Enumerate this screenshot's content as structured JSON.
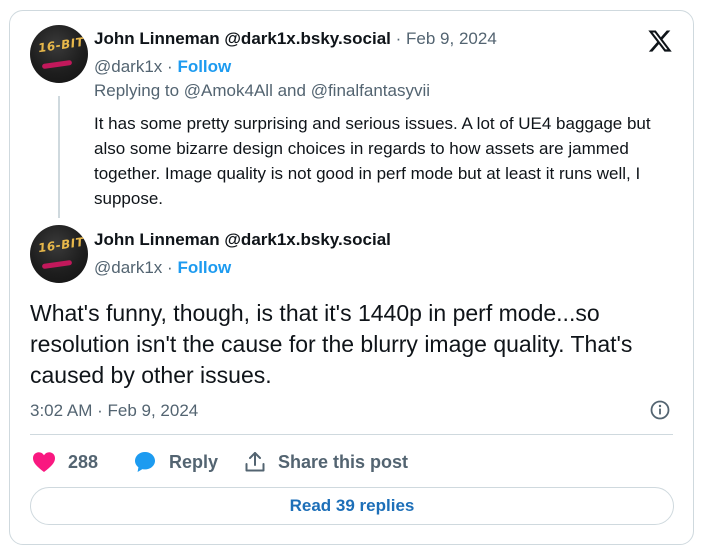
{
  "reply_tweet": {
    "author_name": "John Linneman",
    "author_handle_display": "@dark1x.bsky.social",
    "date": "Feb 9, 2024",
    "handle": "@dark1x",
    "follow_label": "Follow",
    "replying_prefix": "Replying to",
    "mention_1": "@Amok4All",
    "and_word": "and",
    "mention_2": "@finalfantasyvii",
    "text": "It has some pretty surprising and serious issues. A lot of UE4 baggage but also some bizarre design choices in regards to how assets are jammed together. Image quality is not good in perf mode but at least it runs well, I suppose."
  },
  "main_tweet": {
    "author_name": "John Linneman",
    "author_handle_display": "@dark1x.bsky.social",
    "handle": "@dark1x",
    "follow_label": "Follow",
    "text": "What's funny, though, is that it's 1440p in perf mode...so resolution isn't the cause for the blurry image quality. That's caused by other issues.",
    "time": "3:02 AM",
    "date": "Feb 9, 2024"
  },
  "avatar": {
    "badge_text": "16-BIT"
  },
  "separator": "·",
  "actions": {
    "like_count": "288",
    "reply_label": "Reply",
    "share_label": "Share this post"
  },
  "read_replies_label": "Read 39 replies",
  "icons": {
    "logo": "x-logo-icon",
    "info": "info-icon",
    "like": "heart-icon",
    "reply": "speech-bubble-icon",
    "share": "share-icon"
  },
  "colors": {
    "accent": "#1d9bf0",
    "like": "#f91880",
    "muted": "#536471",
    "border": "#cfd9de",
    "read_replies": "#1d6fb8"
  }
}
